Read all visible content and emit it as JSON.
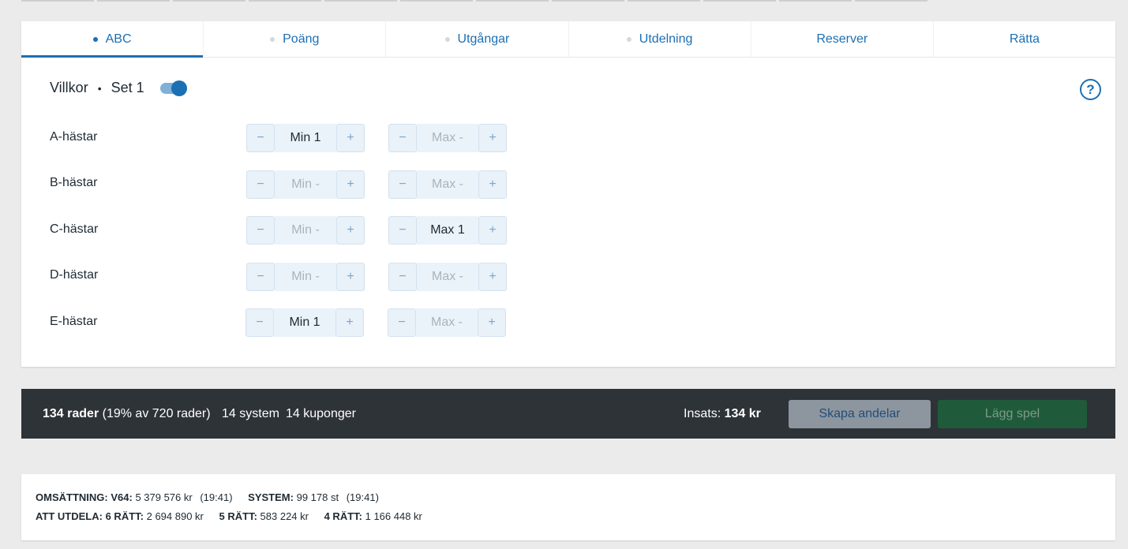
{
  "tabs": [
    {
      "label": "ABC",
      "dot": true,
      "active": true
    },
    {
      "label": "Poäng",
      "dot": true,
      "active": false
    },
    {
      "label": "Utgångar",
      "dot": true,
      "active": false
    },
    {
      "label": "Utdelning",
      "dot": true,
      "active": false
    },
    {
      "label": "Reserver",
      "dot": false,
      "active": false
    },
    {
      "label": "Rätta",
      "dot": false,
      "active": false
    }
  ],
  "villkor": {
    "label": "Villkor",
    "separator": "•",
    "set": "Set 1",
    "toggle_on": true
  },
  "help": {
    "symbol": "?"
  },
  "rows": [
    {
      "label": "A-hästar",
      "min": "Min 1",
      "max": "Max -"
    },
    {
      "label": "B-hästar",
      "min": "Min -",
      "max": "Max -"
    },
    {
      "label": "C-hästar",
      "min": "Min -",
      "max": "Max 1"
    },
    {
      "label": "D-hästar",
      "min": "Min -",
      "max": "Max -"
    },
    {
      "label": "E-hästar",
      "min": "Min 1",
      "max": "Max -"
    }
  ],
  "stepper": {
    "minus": "−",
    "plus": "+"
  },
  "summary": {
    "rows_count": "134 rader",
    "rows_detail": "(19% av 720 rader)",
    "system": "14 system",
    "kuponger": "14 kuponger",
    "insats_label": "Insats:",
    "insats_value": "134 kr",
    "andelar_button": "Skapa andelar",
    "spel_button": "Lägg spel"
  },
  "stats": {
    "omsattning_label": "OMSÄTTNING:",
    "v64_label": "V64:",
    "v64_value": "5 379 576 kr",
    "v64_time": "(19:41)",
    "system_label": "SYSTEM:",
    "system_value": "99 178 st",
    "system_time": "(19:41)",
    "utdela_label": "ATT UTDELA:",
    "r6_label": "6 RÄTT:",
    "r6_value": "2 694 890 kr",
    "r5_label": "5 RÄTT:",
    "r5_value": "583 224 kr",
    "r4_label": "4 RÄTT:",
    "r4_value": "1 166 448 kr"
  }
}
